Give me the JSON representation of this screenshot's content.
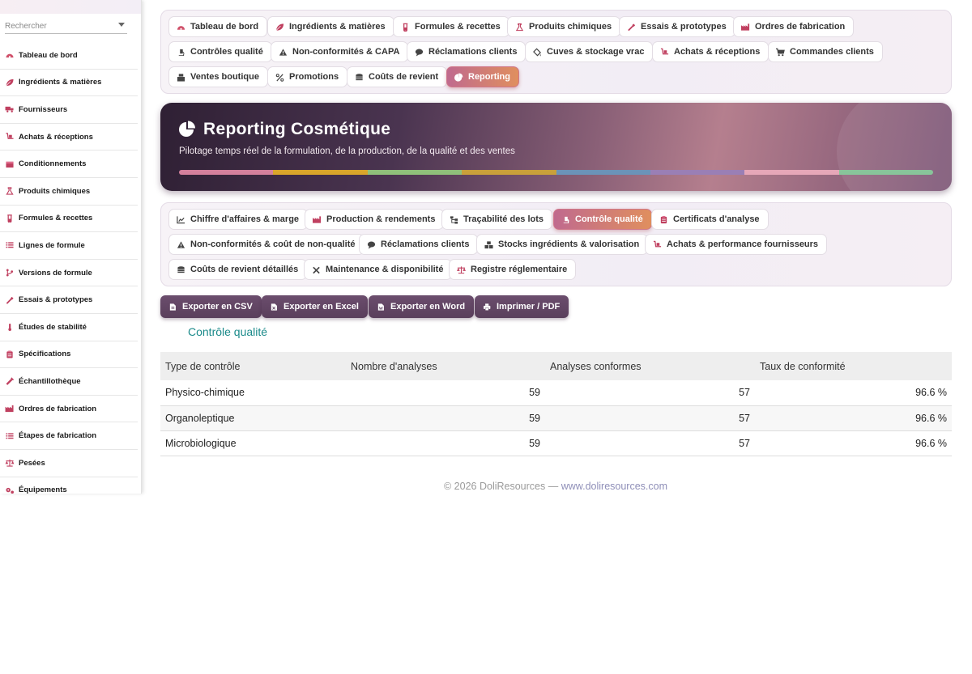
{
  "sidebar": {
    "search_placeholder": "Rechercher",
    "items": [
      {
        "label": "Tableau de bord",
        "icon": "dashboard-icon"
      },
      {
        "label": "Ingrédients & matières",
        "icon": "leaf-icon"
      },
      {
        "label": "Fournisseurs",
        "icon": "truck-icon"
      },
      {
        "label": "Achats & réceptions",
        "icon": "dolly-icon"
      },
      {
        "label": "Conditionnements",
        "icon": "box-icon"
      },
      {
        "label": "Produits chimiques",
        "icon": "flask-icon"
      },
      {
        "label": "Formules & recettes",
        "icon": "beaker-icon"
      },
      {
        "label": "Lignes de formule",
        "icon": "list-icon"
      },
      {
        "label": "Versions de formule",
        "icon": "branch-icon"
      },
      {
        "label": "Essais & prototypes",
        "icon": "pipette-icon"
      },
      {
        "label": "Études de stabilité",
        "icon": "thermometer-icon"
      },
      {
        "label": "Spécifications",
        "icon": "clipboard-icon"
      },
      {
        "label": "Échantillothèque",
        "icon": "vial-icon"
      },
      {
        "label": "Ordres de fabrication",
        "icon": "factory-icon"
      },
      {
        "label": "Étapes de fabrication",
        "icon": "steps-icon"
      },
      {
        "label": "Pesées",
        "icon": "scale-icon"
      },
      {
        "label": "Équipements",
        "icon": "gears-icon"
      }
    ]
  },
  "top_tabs": [
    {
      "label": "Tableau de bord",
      "icon": "dashboard-icon"
    },
    {
      "label": "Ingrédients & matières",
      "icon": "leaf-icon"
    },
    {
      "label": "Formules & recettes",
      "icon": "beaker-icon"
    },
    {
      "label": "Produits chimiques",
      "icon": "flask-icon"
    },
    {
      "label": "Essais & prototypes",
      "icon": "pipette-icon"
    },
    {
      "label": "Ordres de fabrication",
      "icon": "factory-icon"
    },
    {
      "label": "Contrôles qualité",
      "icon": "microscope-icon"
    },
    {
      "label": "Non-conformités & CAPA",
      "icon": "warning-icon"
    },
    {
      "label": "Réclamations clients",
      "icon": "comment-icon"
    },
    {
      "label": "Cuves & stockage vrac",
      "icon": "fill-icon"
    },
    {
      "label": "Achats & réceptions",
      "icon": "dolly-icon"
    },
    {
      "label": "Commandes clients",
      "icon": "cart-icon"
    },
    {
      "label": "Ventes boutique",
      "icon": "register-icon"
    },
    {
      "label": "Promotions",
      "icon": "percent-icon"
    },
    {
      "label": "Coûts de revient",
      "icon": "coins-icon"
    },
    {
      "label": "Reporting",
      "icon": "pie-chart-icon",
      "active": true
    }
  ],
  "hero": {
    "title": "Reporting Cosmétique",
    "subtitle": "Pilotage temps réel de la formulation, de la production, de la qualité et des ventes",
    "bar_colors": [
      "#d4809c",
      "#d9a52a",
      "#8fc07a",
      "#c9a03a",
      "#6b93b8",
      "#9a7fb5",
      "#e6a7b8",
      "#88c49a"
    ]
  },
  "report_tabs": [
    {
      "label": "Chiffre d'affaires & marge",
      "icon": "line-chart-icon"
    },
    {
      "label": "Production & rendements",
      "icon": "factory-icon"
    },
    {
      "label": "Traçabilité des lots",
      "icon": "tree-icon"
    },
    {
      "label": "Contrôle qualité",
      "icon": "microscope-icon",
      "active": true
    },
    {
      "label": "Certificats d'analyse",
      "icon": "clipboard-icon"
    },
    {
      "label": "Non-conformités & coût de non-qualité",
      "icon": "warning-icon"
    },
    {
      "label": "Réclamations clients",
      "icon": "comment-icon"
    },
    {
      "label": "Stocks ingrédients & valorisation",
      "icon": "boxes-icon"
    },
    {
      "label": "Achats & performance fournisseurs",
      "icon": "dolly-icon"
    },
    {
      "label": "Coûts de revient détaillés",
      "icon": "coins-icon"
    },
    {
      "label": "Maintenance & disponibilité",
      "icon": "tools-icon"
    },
    {
      "label": "Registre réglementaire",
      "icon": "scale-icon"
    }
  ],
  "exports": [
    {
      "label": "Exporter en CSV",
      "icon": "file-csv-icon"
    },
    {
      "label": "Exporter en Excel",
      "icon": "file-excel-icon"
    },
    {
      "label": "Exporter en Word",
      "icon": "file-word-icon"
    },
    {
      "label": "Imprimer / PDF",
      "icon": "print-icon"
    }
  ],
  "section_title": "Contrôle qualité",
  "table": {
    "headers": [
      "Type de contrôle",
      "Nombre d'analyses",
      "Analyses conformes",
      "Taux de conformité"
    ],
    "rows": [
      [
        "Physico-chimique",
        "59",
        "57",
        "96.6 %"
      ],
      [
        "Organoleptique",
        "59",
        "57",
        "96.6 %"
      ],
      [
        "Microbiologique",
        "59",
        "57",
        "96.6 %"
      ]
    ]
  },
  "footer": {
    "text": "© 2026 DoliResources — ",
    "link": "www.doliresources.com"
  },
  "colors": {
    "accent": "#5e4360",
    "active_tab_start": "#c06a8e",
    "active_tab_end": "#e08f5e",
    "section_title": "#1b8a8a"
  }
}
